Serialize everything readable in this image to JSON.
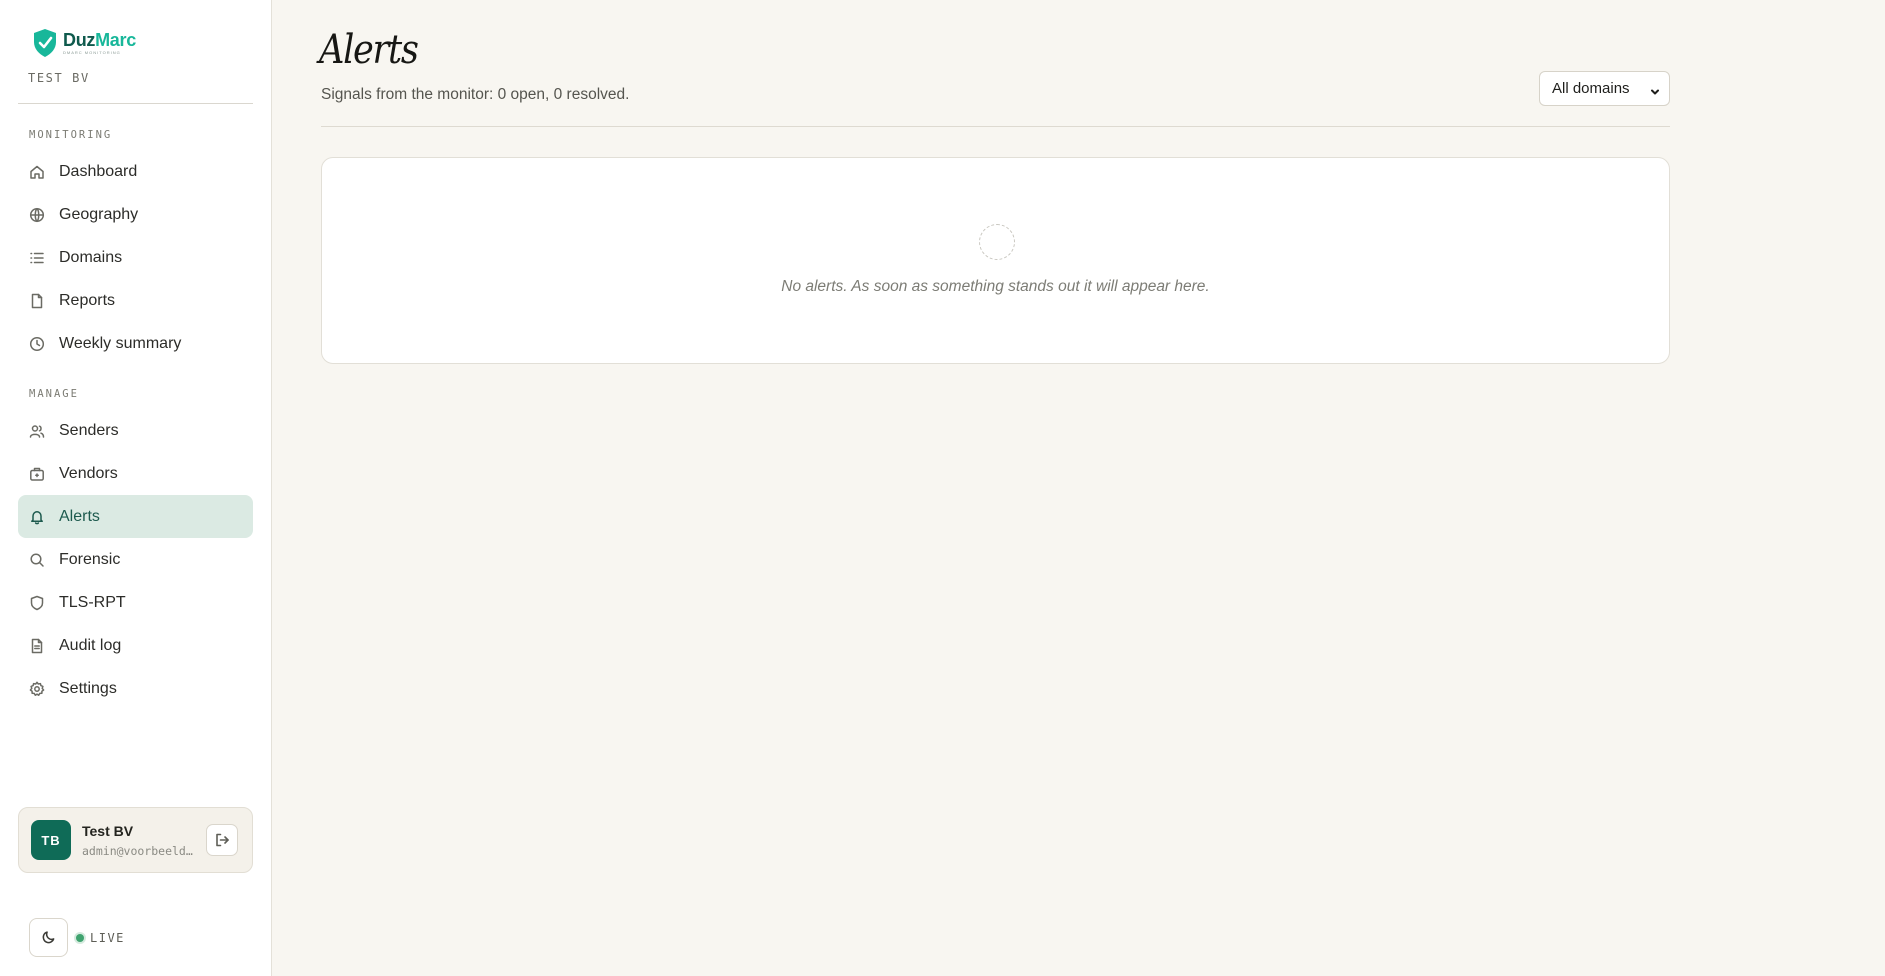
{
  "brand": {
    "name_part1": "Duz",
    "name_part2": "Marc",
    "tagline": "DMARC MONITORING",
    "org": "TEST BV"
  },
  "sidebar": {
    "sections": [
      {
        "heading": "MONITORING",
        "items": [
          {
            "label": "Dashboard",
            "icon": "home-icon"
          },
          {
            "label": "Geography",
            "icon": "globe-icon"
          },
          {
            "label": "Domains",
            "icon": "list-icon"
          },
          {
            "label": "Reports",
            "icon": "file-icon"
          },
          {
            "label": "Weekly summary",
            "icon": "clock-icon"
          }
        ]
      },
      {
        "heading": "MANAGE",
        "items": [
          {
            "label": "Senders",
            "icon": "users-icon"
          },
          {
            "label": "Vendors",
            "icon": "briefcase-icon"
          },
          {
            "label": "Alerts",
            "icon": "bell-icon",
            "active": true
          },
          {
            "label": "Forensic",
            "icon": "search-icon"
          },
          {
            "label": "TLS-RPT",
            "icon": "shield-icon"
          },
          {
            "label": "Audit log",
            "icon": "document-icon"
          },
          {
            "label": "Settings",
            "icon": "gear-icon"
          }
        ]
      }
    ]
  },
  "user": {
    "initials": "TB",
    "name": "Test BV",
    "email": "admin@voorbeeld.nl"
  },
  "status": {
    "live_label": "LIVE"
  },
  "page": {
    "title": "Alerts",
    "subtitle": "Signals from the monitor: 0 open, 0 resolved.",
    "domain_filter": "All domains",
    "empty_message": "No alerts. As soon as something stands out it will appear here."
  },
  "colors": {
    "accent": "#0f6b57",
    "active_bg": "#dbeae3",
    "live": "#3fa36f",
    "background": "#f8f6f1"
  }
}
